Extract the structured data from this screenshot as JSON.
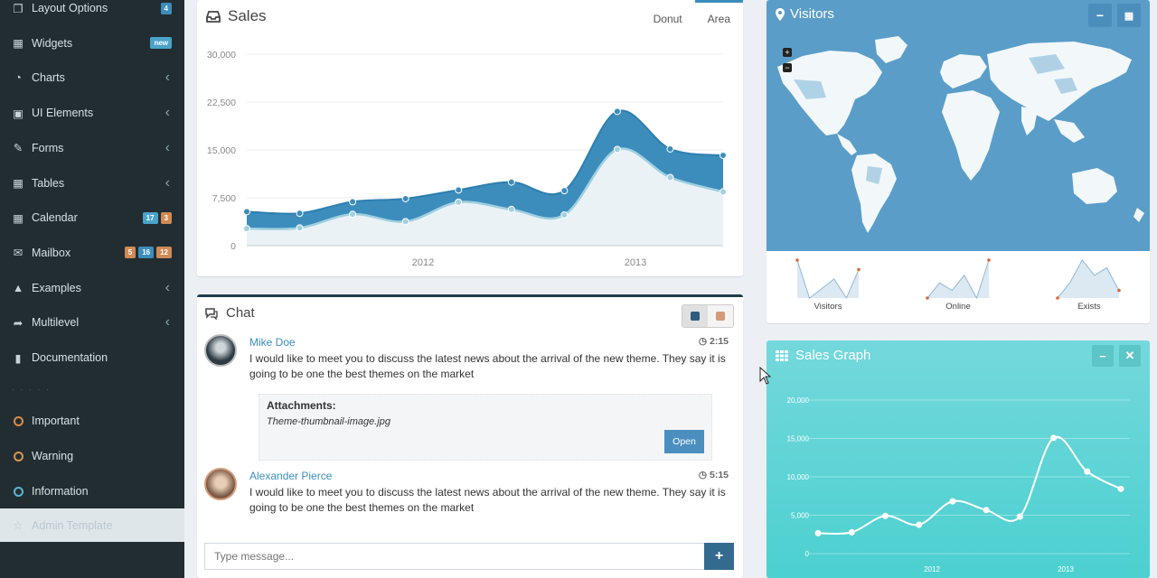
{
  "sidebar": {
    "items": [
      {
        "label": "Layout Options",
        "icon": "copy-icon",
        "badges": [
          "4"
        ]
      },
      {
        "label": "Widgets",
        "icon": "th-icon",
        "badges": [
          "new"
        ]
      },
      {
        "label": "Charts",
        "icon": "pie-chart-icon"
      },
      {
        "label": "UI Elements",
        "icon": "laptop-icon"
      },
      {
        "label": "Forms",
        "icon": "edit-icon"
      },
      {
        "label": "Tables",
        "icon": "table-icon"
      },
      {
        "label": "Calendar",
        "icon": "calendar-icon",
        "badges": [
          "17",
          "3"
        ]
      },
      {
        "label": "Mailbox",
        "icon": "envelope-icon",
        "badges": [
          "5",
          "16",
          "12"
        ]
      },
      {
        "label": "Examples",
        "icon": "folder-icon"
      },
      {
        "label": "Multilevel",
        "icon": "share-icon"
      },
      {
        "label": "Documentation",
        "icon": "book-icon"
      }
    ],
    "labels": [
      {
        "label": "Important",
        "color": "#dd8b45"
      },
      {
        "label": "Warning",
        "color": "#d8964f"
      },
      {
        "label": "Information",
        "color": "#5ab7cf"
      }
    ],
    "active": {
      "label": "Admin Template"
    }
  },
  "sales": {
    "title": "Sales",
    "tabs": [
      "Donut",
      "Area"
    ],
    "active_tab": "Area"
  },
  "chat": {
    "title": "Chat",
    "messages": [
      {
        "name": "Mike Doe",
        "time": "2:15",
        "text": "I would like to meet you to discuss the latest news about the arrival of the new theme. They say it is going to be one the best themes on the market",
        "attachment": {
          "title": "Attachments:",
          "file": "Theme-thumbnail-image.jpg",
          "button": "Open"
        }
      },
      {
        "name": "Alexander Pierce",
        "time": "5:15",
        "text": "I would like to meet you to discuss the latest news about the arrival of the new theme. They say it is going to be one the best themes on the market"
      }
    ],
    "input_placeholder": "Type message...",
    "send_label": "+"
  },
  "visitors": {
    "title": "Visitors",
    "sparklines": [
      {
        "label": "Visitors",
        "values": [
          5,
          1,
          2,
          3,
          1,
          4
        ]
      },
      {
        "label": "Online",
        "values": [
          1,
          3,
          2,
          4,
          1,
          6
        ]
      },
      {
        "label": "Exists",
        "values": [
          1,
          3,
          6,
          4,
          5,
          2
        ]
      }
    ]
  },
  "sales_graph": {
    "title": "Sales Graph"
  },
  "chart_data": [
    {
      "type": "area",
      "x_labels": [
        "2012",
        "2013"
      ],
      "yticks": [
        "0",
        "7,500",
        "15,000",
        "22,500",
        "30,000"
      ],
      "ylim": [
        0,
        30000
      ],
      "series": [
        {
          "values": [
            2666,
            2778,
            4912,
            3767,
            6810,
            5670,
            4820,
            15073,
            10687,
            8432
          ]
        },
        {
          "values": [
            2666,
            2294,
            1969,
            3597,
            1914,
            4293,
            3795,
            5967,
            4460,
            5713
          ]
        }
      ],
      "colors": [
        "#3c8dbc",
        "#a0d0e0"
      ]
    },
    {
      "type": "line",
      "x_labels": [
        "2012",
        "2013"
      ],
      "yticks": [
        "0",
        "5,000",
        "10,000",
        "15,000",
        "20,000"
      ],
      "ylim": [
        0,
        20000
      ],
      "values": [
        2666,
        2778,
        4912,
        3767,
        6810,
        5670,
        4820,
        15073,
        10687,
        8432
      ]
    }
  ]
}
